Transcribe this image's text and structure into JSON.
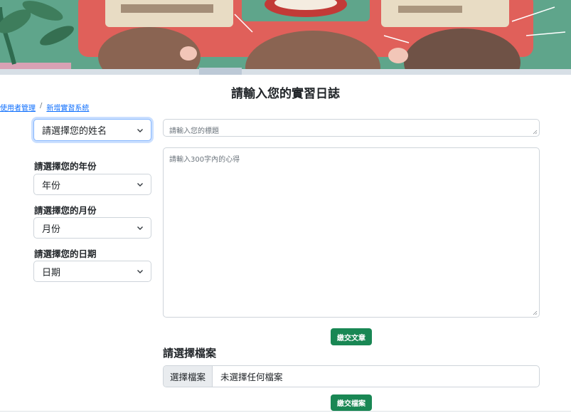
{
  "page": {
    "title": "請輸入您的實習日誌"
  },
  "breadcrumb": {
    "items": [
      "使用者管理",
      "新增實習系統"
    ],
    "separator": "/"
  },
  "form": {
    "name_select": "請選擇您的姓名",
    "year_label": "請選擇您的年份",
    "year_select": "年份",
    "month_label": "請選擇您的月份",
    "month_select": "月份",
    "day_label": "請選擇您的日期",
    "day_select": "日期",
    "title_placeholder": "請輸入您的標題",
    "content_placeholder": "請輸入300字內的心得",
    "submit_article": "繳交文章"
  },
  "file_section": {
    "title": "請選擇檔案",
    "choose_button": "選擇檔案",
    "no_file_text": "未選擇任何檔案",
    "submit_file": "繳交檔案"
  },
  "icons": {
    "select": "chevron-down-icon",
    "resize": "resize-handle-icon"
  },
  "colors": {
    "primary_button": "#198754",
    "link": "#0d6efd",
    "banner": "#5fa58b"
  }
}
